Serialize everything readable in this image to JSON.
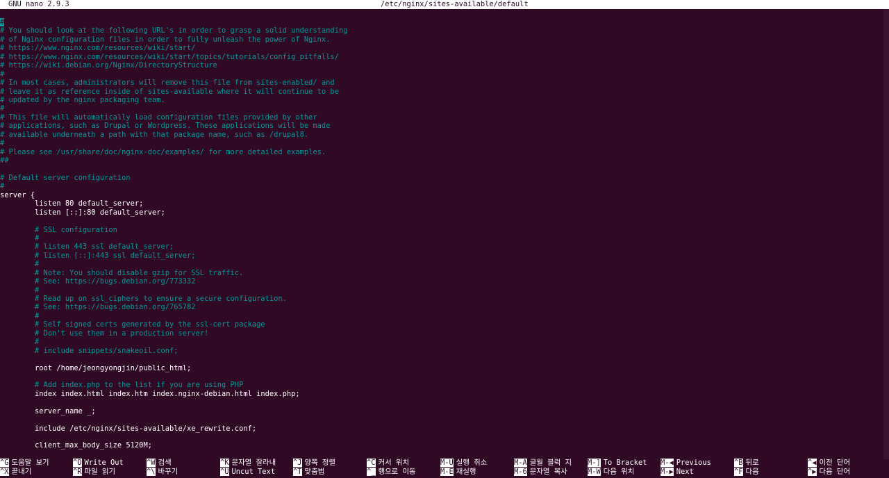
{
  "title": {
    "version": "GNU nano 2.9.3",
    "file": "/etc/nginx/sites-available/default"
  },
  "lines": [
    {
      "t": "#",
      "c": "c",
      "cursor": true
    },
    {
      "t": "# You should look at the following URL's in order to grasp a solid understanding",
      "c": "c"
    },
    {
      "t": "# of Nginx configuration files in order to fully unleash the power of Nginx.",
      "c": "c"
    },
    {
      "t": "# https://www.nginx.com/resources/wiki/start/",
      "c": "c"
    },
    {
      "t": "# https://www.nginx.com/resources/wiki/start/topics/tutorials/config_pitfalls/",
      "c": "c"
    },
    {
      "t": "# https://wiki.debian.org/Nginx/DirectoryStructure",
      "c": "c"
    },
    {
      "t": "#",
      "c": "c"
    },
    {
      "t": "# In most cases, administrators will remove this file from sites-enabled/ and",
      "c": "c"
    },
    {
      "t": "# leave it as reference inside of sites-available where it will continue to be",
      "c": "c"
    },
    {
      "t": "# updated by the nginx packaging team.",
      "c": "c"
    },
    {
      "t": "#",
      "c": "c"
    },
    {
      "t": "# This file will automatically load configuration files provided by other",
      "c": "c"
    },
    {
      "t": "# applications, such as Drupal or Wordpress. These applications will be made",
      "c": "c"
    },
    {
      "t": "# available underneath a path with that package name, such as /drupal8.",
      "c": "c"
    },
    {
      "t": "#",
      "c": "c"
    },
    {
      "t": "# Please see /usr/share/doc/nginx-doc/examples/ for more detailed examples.",
      "c": "c"
    },
    {
      "t": "##",
      "c": "c"
    },
    {
      "t": "",
      "c": "k"
    },
    {
      "t": "# Default server configuration",
      "c": "c"
    },
    {
      "t": "#",
      "c": "c"
    },
    {
      "t": "server {",
      "c": "k"
    },
    {
      "t": "        listen 80 default_server;",
      "c": "k"
    },
    {
      "t": "        listen [::]:80 default_server;",
      "c": "k"
    },
    {
      "t": "",
      "c": "k"
    },
    {
      "t": "        # SSL configuration",
      "c": "c"
    },
    {
      "t": "        #",
      "c": "c"
    },
    {
      "t": "        # listen 443 ssl default_server;",
      "c": "c"
    },
    {
      "t": "        # listen [::]:443 ssl default_server;",
      "c": "c"
    },
    {
      "t": "        #",
      "c": "c"
    },
    {
      "t": "        # Note: You should disable gzip for SSL traffic.",
      "c": "c"
    },
    {
      "t": "        # See: https://bugs.debian.org/773332",
      "c": "c"
    },
    {
      "t": "        #",
      "c": "c"
    },
    {
      "t": "        # Read up on ssl_ciphers to ensure a secure configuration.",
      "c": "c"
    },
    {
      "t": "        # See: https://bugs.debian.org/765782",
      "c": "c"
    },
    {
      "t": "        #",
      "c": "c"
    },
    {
      "t": "        # Self signed certs generated by the ssl-cert package",
      "c": "c"
    },
    {
      "t": "        # Don't use them in a production server!",
      "c": "c"
    },
    {
      "t": "        #",
      "c": "c"
    },
    {
      "t": "        # include snippets/snakeoil.conf;",
      "c": "c"
    },
    {
      "t": "",
      "c": "k"
    },
    {
      "t": "        root /home/jeongyongjin/public_html;",
      "c": "k"
    },
    {
      "t": "",
      "c": "k"
    },
    {
      "t": "        # Add index.php to the list if you are using PHP",
      "c": "c"
    },
    {
      "t": "        index index.html index.htm index.nginx-debian.html index.php;",
      "c": "k"
    },
    {
      "t": "",
      "c": "k"
    },
    {
      "t": "        server_name _;",
      "c": "k"
    },
    {
      "t": "",
      "c": "k"
    },
    {
      "t": "        include /etc/nginx/sites-available/xe_rewrite.conf;",
      "c": "k"
    },
    {
      "t": "",
      "c": "k"
    },
    {
      "t": "        client_max_body_size 5120M;",
      "c": "k"
    }
  ],
  "shortcuts": [
    {
      "key": "^G",
      "label": "도움말 보기"
    },
    {
      "key": "^X",
      "label": "끝내기"
    },
    {
      "key": "^O",
      "label": "Write Out"
    },
    {
      "key": "^R",
      "label": "파일 읽기"
    },
    {
      "key": "^W",
      "label": "검색"
    },
    {
      "key": "^\\",
      "label": "바꾸기"
    },
    {
      "key": "^K",
      "label": "문자열 잘라내"
    },
    {
      "key": "^U",
      "label": "Uncut Text"
    },
    {
      "key": "^J",
      "label": "양쪽 정렬"
    },
    {
      "key": "^T",
      "label": "맞춤법"
    },
    {
      "key": "^C",
      "label": "커서 위치"
    },
    {
      "key": "^_",
      "label": "행으로 이동"
    },
    {
      "key": "M-U",
      "label": "실행 취소"
    },
    {
      "key": "M-E",
      "label": "재실행"
    },
    {
      "key": "M-A",
      "label": "글월 블럭 지"
    },
    {
      "key": "M-6",
      "label": "문자열 복사"
    },
    {
      "key": "M-]",
      "label": "To Bracket"
    },
    {
      "key": "M-W",
      "label": "다음 위치"
    },
    {
      "key": "M-◀",
      "label": "Previous"
    },
    {
      "key": "M-▶",
      "label": "Next"
    },
    {
      "key": "^B",
      "label": "뒤로"
    },
    {
      "key": "^F",
      "label": "다음"
    },
    {
      "key": "^◀",
      "label": "이전 단어"
    },
    {
      "key": "^▶",
      "label": "다음 단어"
    }
  ]
}
